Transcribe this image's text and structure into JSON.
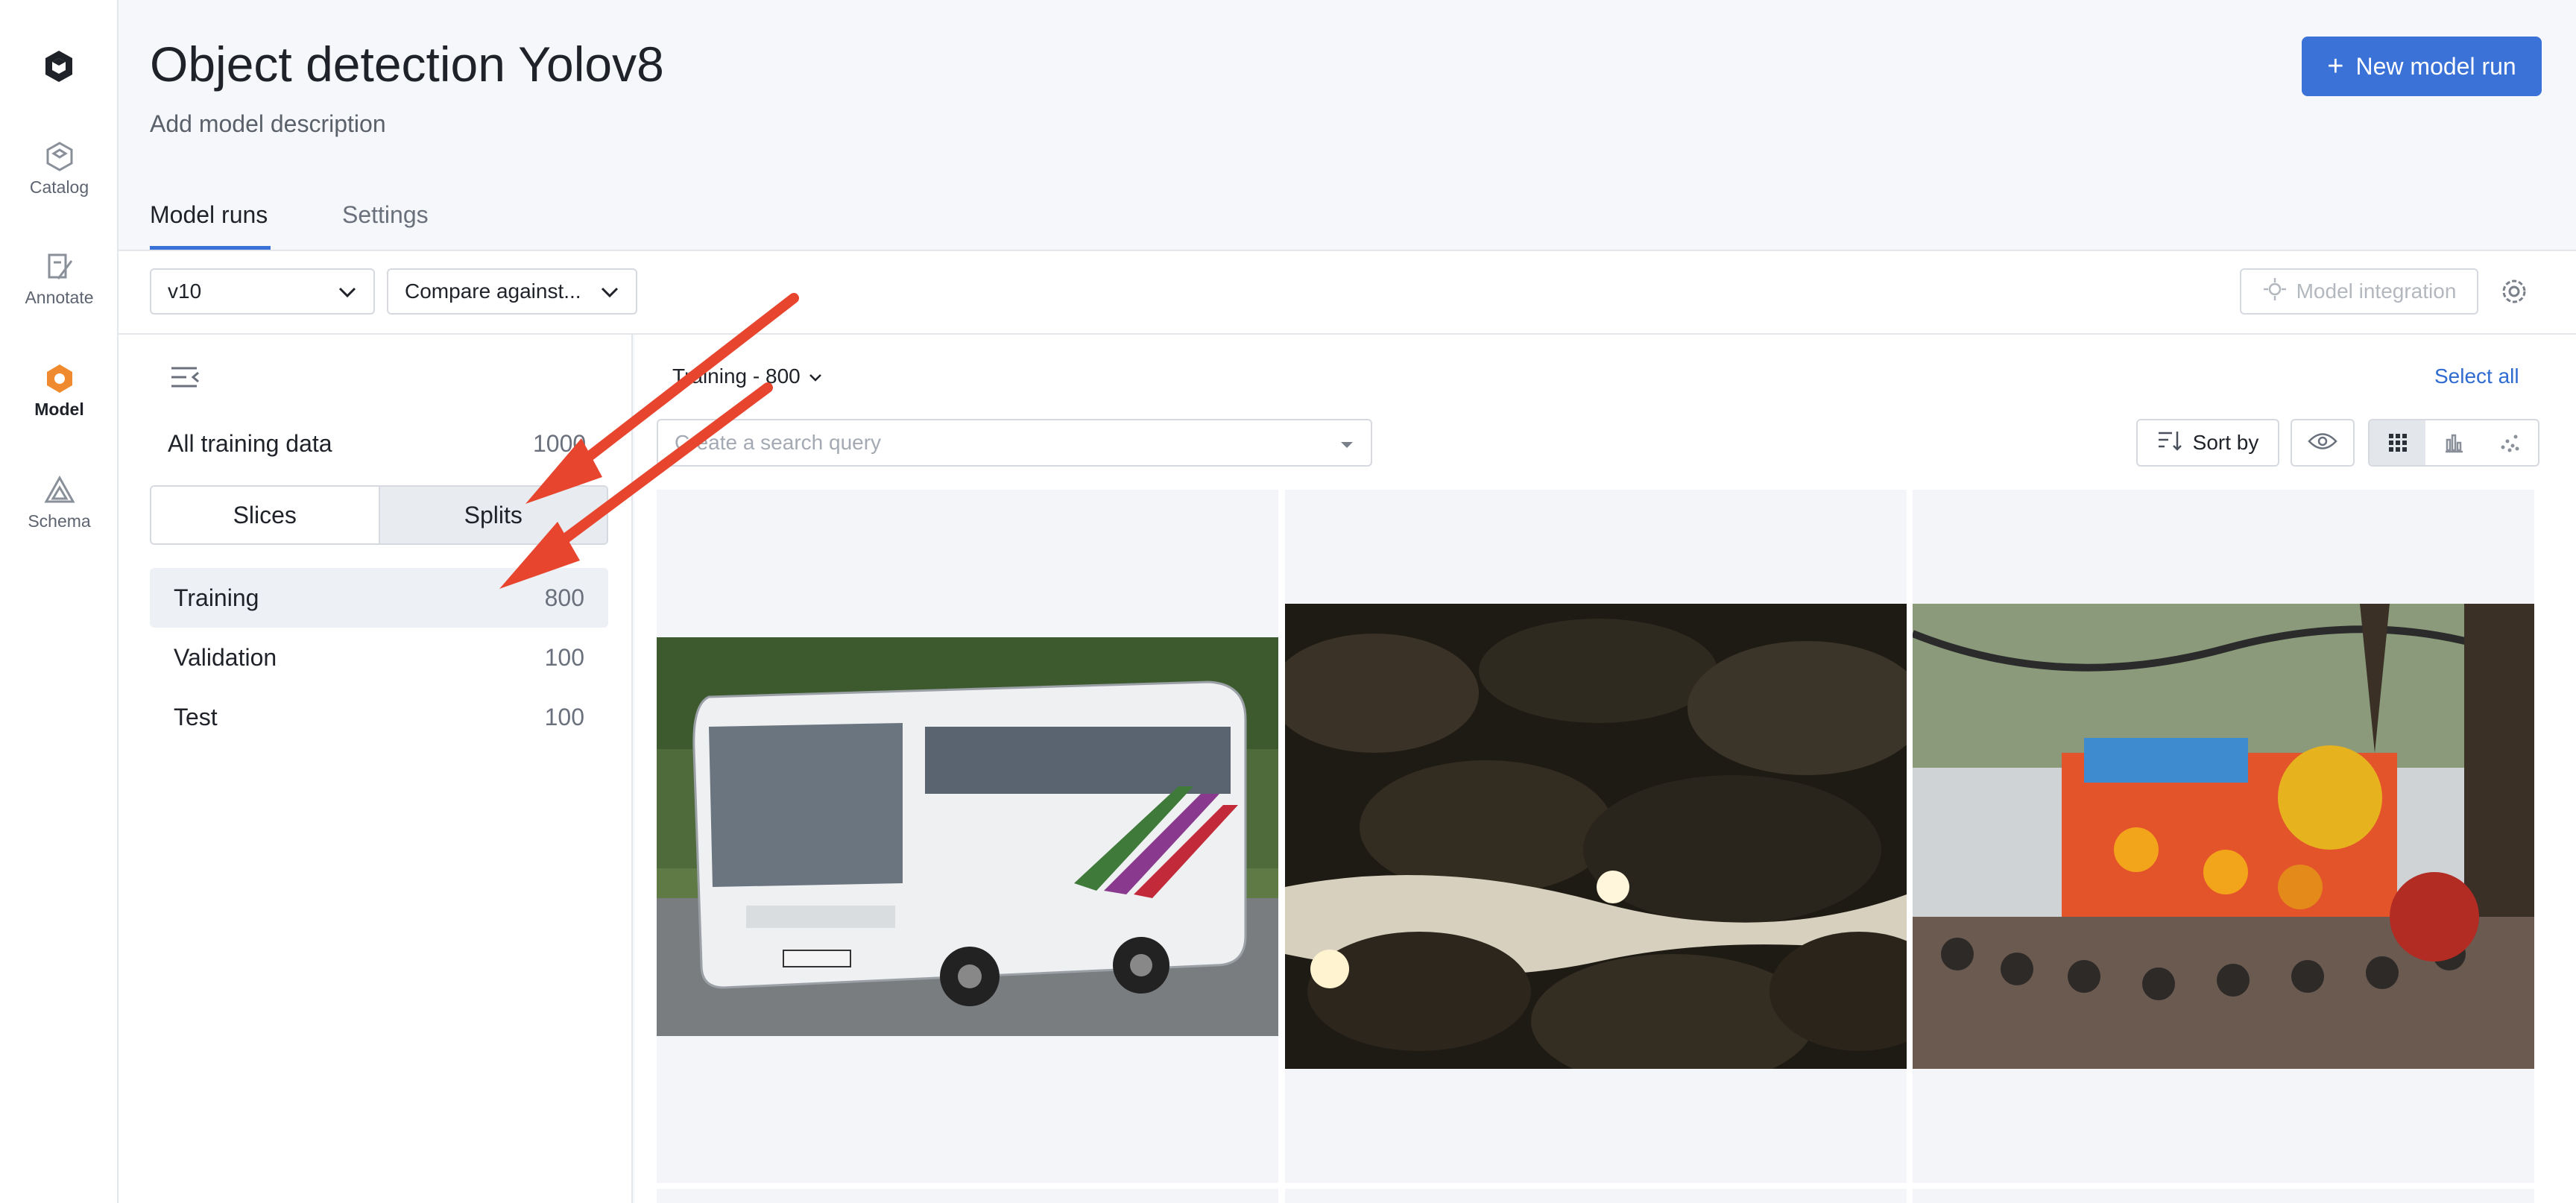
{
  "nav": {
    "items": [
      {
        "label": "Catalog",
        "icon": "catalog-icon"
      },
      {
        "label": "Annotate",
        "icon": "annotate-icon"
      },
      {
        "label": "Model",
        "icon": "model-icon",
        "active": true
      },
      {
        "label": "Schema",
        "icon": "schema-icon"
      }
    ]
  },
  "header": {
    "title": "Object detection Yolov8",
    "description": "Add model description",
    "new_run_label": "New model run",
    "tabs": [
      {
        "label": "Model runs",
        "active": true
      },
      {
        "label": "Settings",
        "active": false
      }
    ]
  },
  "toolbar": {
    "version": "v10",
    "compare_placeholder": "Compare against...",
    "integration_label": "Model integration"
  },
  "left_panel": {
    "all_training_label": "All training data",
    "all_training_count": "1000",
    "segments": [
      {
        "label": "Slices",
        "active": false
      },
      {
        "label": "Splits",
        "active": true
      }
    ],
    "splits": [
      {
        "label": "Training",
        "count": "800",
        "active": true
      },
      {
        "label": "Validation",
        "count": "100",
        "active": false
      },
      {
        "label": "Test",
        "count": "100",
        "active": false
      }
    ]
  },
  "main": {
    "split_dropdown": "Training - 800",
    "select_all": "Select all",
    "search_placeholder": "Create a search query",
    "sort_label": "Sort by"
  },
  "colors": {
    "accent": "#3a72d8",
    "model_orange": "#f08a2e",
    "annotation_arrow": "#e8452f"
  }
}
